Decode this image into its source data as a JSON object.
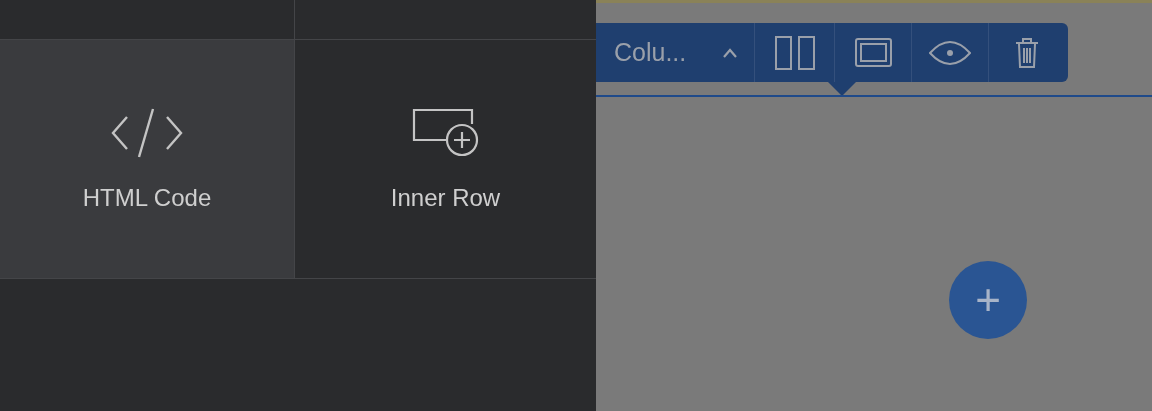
{
  "elements_panel": {
    "cells": [
      {
        "label": "HTML Code",
        "kind": "code",
        "highlighted": true
      },
      {
        "label": "Inner Row",
        "kind": "row",
        "highlighted": false
      }
    ]
  },
  "column_toolbar": {
    "label": "Colu...",
    "tools": [
      {
        "kind": "columns"
      },
      {
        "kind": "frame"
      },
      {
        "kind": "visibility"
      },
      {
        "kind": "delete"
      }
    ]
  },
  "canvas": {
    "add_button": "+"
  }
}
